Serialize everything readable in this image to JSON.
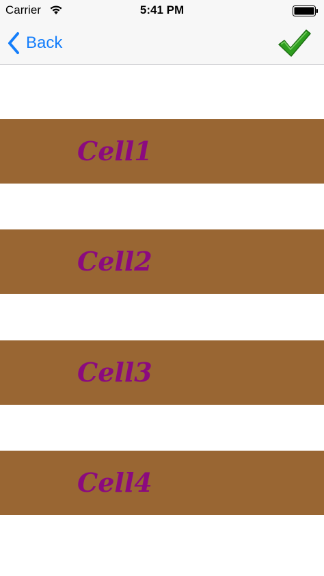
{
  "status_bar": {
    "carrier": "Carrier",
    "time": "5:41 PM",
    "wifi_icon": "wifi-icon",
    "battery_icon": "battery-icon"
  },
  "nav_bar": {
    "back_label": "Back",
    "back_icon": "chevron-left-icon",
    "action_icon": "checkmark-icon",
    "tint_color": "#147efb",
    "check_color": "#2e9e1f"
  },
  "cells": [
    {
      "label": "Cell1"
    },
    {
      "label": "Cell2"
    },
    {
      "label": "Cell3"
    },
    {
      "label": "Cell4"
    }
  ],
  "colors": {
    "cell_background": "#996633",
    "cell_text": "#8b0a7f",
    "page_background": "#ffffff"
  }
}
